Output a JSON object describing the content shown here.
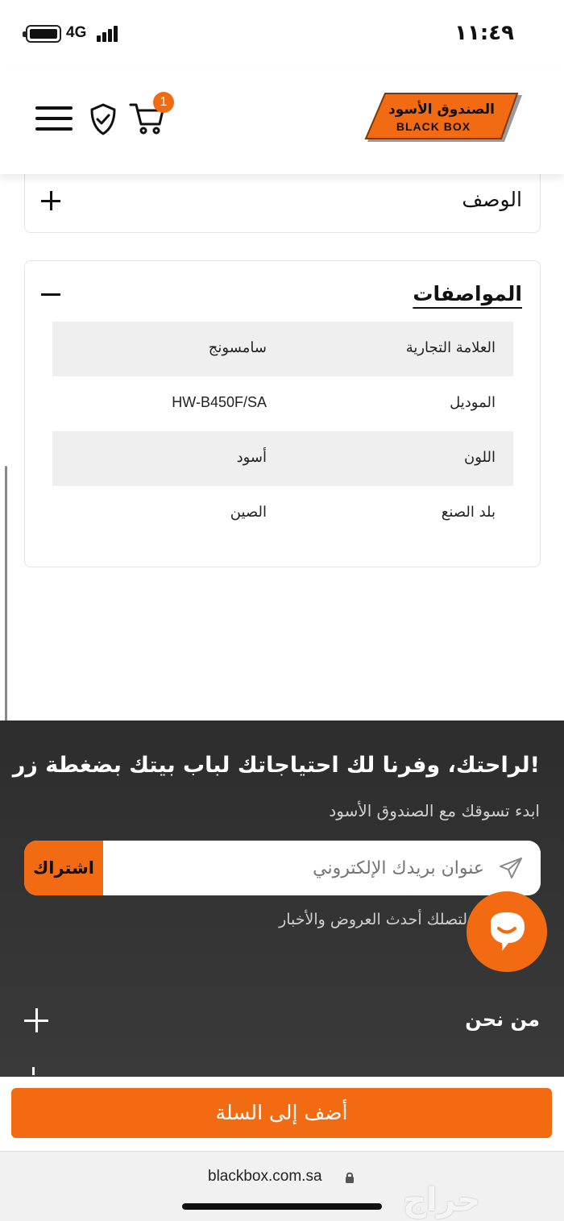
{
  "status_bar": {
    "network": "4G",
    "time": "١١:٤٩"
  },
  "header": {
    "cart_count": "1",
    "logo": {
      "arabic_name": "الصندوق الأسود",
      "english_name": "BLACK BOX"
    }
  },
  "accordions": {
    "description": {
      "title": "الوصف"
    },
    "specifications": {
      "title": "المواصفات",
      "rows": [
        {
          "key": "العلامة التجارية",
          "value": "سامسونج"
        },
        {
          "key": "الموديل",
          "value": "HW-B450F/SA"
        },
        {
          "key": "اللون",
          "value": "أسود"
        },
        {
          "key": "بلد الصنع",
          "value": "الصين"
        }
      ]
    }
  },
  "footer": {
    "headline": "لراحتك، وفرنا لك احتياجاتك لباب بيتك بضغطة زر!",
    "subline": "ابدء تسوقك مع الصندوق الأسود",
    "email_placeholder": "عنوان بريدك الإلكتروني",
    "subscribe_label": "اشتراك",
    "note": "لتصلك أحدث العروض والأخبار",
    "about_label": "من نحن"
  },
  "cart_bar": {
    "add_to_cart_label": "أضف إلى السلة"
  },
  "browser": {
    "url": "blackbox.com.sa"
  },
  "watermark": "حراج",
  "colors": {
    "accent": "#f26b12",
    "footer_bg": "#2d2d2d"
  }
}
